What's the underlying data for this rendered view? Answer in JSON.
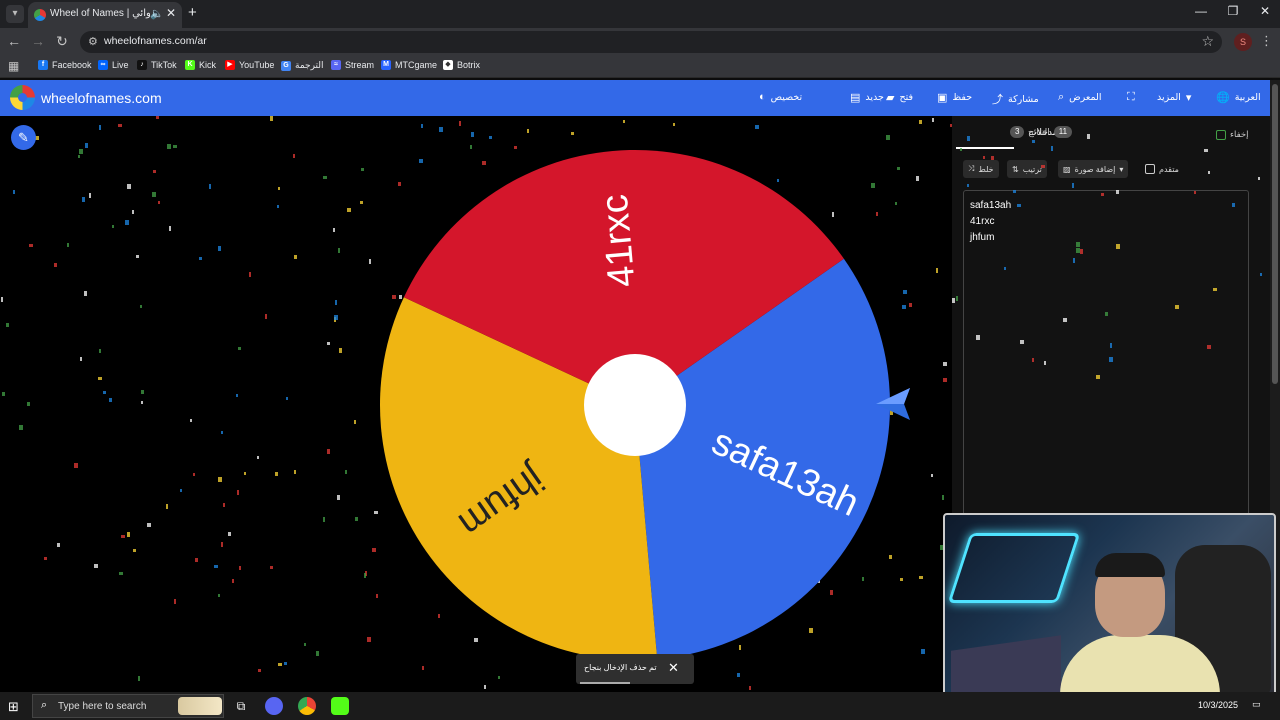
{
  "browser": {
    "tab_title": "Wheel of Names | العشوائي",
    "url": "wheelofnames.com/ar",
    "profile_initial": "S",
    "bookmarks": [
      {
        "label": "Facebook",
        "color": "#1877f2",
        "glyph": "f"
      },
      {
        "label": "Live",
        "color": "#0064ff",
        "glyph": "∞"
      },
      {
        "label": "TikTok",
        "color": "#111111",
        "glyph": "♪"
      },
      {
        "label": "Kick",
        "color": "#53fc18",
        "glyph": "K"
      },
      {
        "label": "YouTube",
        "color": "#ff0000",
        "glyph": "▶"
      },
      {
        "label": "الترجمة",
        "color": "#4285f4",
        "glyph": "G"
      },
      {
        "label": "Stream",
        "color": "#5865f2",
        "glyph": "≈"
      },
      {
        "label": "MTCgame",
        "color": "#2962ff",
        "glyph": "M"
      },
      {
        "label": "Botrix",
        "color": "#ffffff",
        "glyph": "◆"
      }
    ]
  },
  "site": {
    "title": "wheelofnames.com",
    "menu": [
      {
        "label": "العربية",
        "icon": "globe-icon",
        "glyph": "🌐"
      },
      {
        "label": "المزيد",
        "icon": "chevron-down-icon",
        "glyph": "▾"
      },
      {
        "label": "",
        "icon": "fullscreen-icon",
        "glyph": "⛶"
      },
      {
        "label": "المعرض",
        "icon": "search-icon",
        "glyph": "⌕"
      },
      {
        "label": "مشاركة",
        "icon": "share-icon",
        "glyph": "⤴"
      },
      {
        "label": "حفظ",
        "icon": "save-icon",
        "glyph": "▣"
      },
      {
        "label": "فتح",
        "icon": "folder-icon",
        "glyph": "▰"
      },
      {
        "label": "جديد",
        "icon": "new-file-icon",
        "glyph": "▤"
      },
      {
        "label": "تخصيص",
        "icon": "palette-icon",
        "glyph": "◐"
      }
    ],
    "accent": "#3369e8"
  },
  "wheel": {
    "segments": [
      {
        "label": "safa13ah",
        "color": "#3369e8"
      },
      {
        "label": "jhfum",
        "color": "#efb512"
      },
      {
        "label": "41rxc",
        "color": "#d4162b"
      }
    ]
  },
  "panel": {
    "tab_entries": "مدخلات",
    "entries_count": "3",
    "tab_results": "النتائج",
    "results_count": "11",
    "hide_label": "إخفاء",
    "shuffle_label": "خلط",
    "sort_label": "ترتيب",
    "add_image_label": "إضافة صورة",
    "advanced_label": "متقدم",
    "entries": [
      "safa13ah",
      "41rxc",
      "jhfum"
    ]
  },
  "toast": {
    "message": "تم حذف الإدخال بنجاح"
  },
  "taskbar": {
    "search_placeholder": "Type here to search",
    "date": "10/3/2025"
  }
}
